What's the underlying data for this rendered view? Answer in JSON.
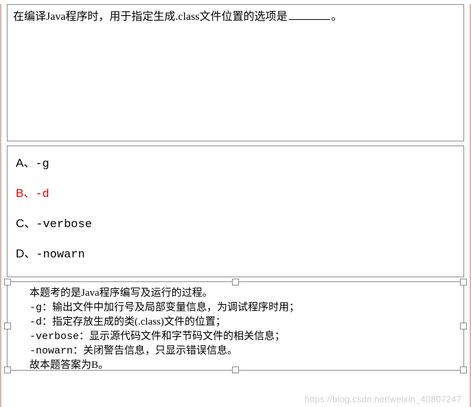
{
  "question": {
    "prefix": "在编译Java程序时，用于指定生成.class文件位置的选项是",
    "suffix": "。"
  },
  "options": [
    {
      "label": "A、",
      "value": "-g",
      "correct": false
    },
    {
      "label": "B、",
      "value": "-d",
      "correct": true
    },
    {
      "label": "C、",
      "value": "-verbose",
      "correct": false
    },
    {
      "label": "D、",
      "value": "-nowarn",
      "correct": false
    }
  ],
  "explanation": {
    "line1": "本题考的是Java程序编写及运行的过程。",
    "line2_flag": "-g：",
    "line2_rest": "输出文件中加行号及局部变量信息，为调试程序时用；",
    "line3_flag": "-d：",
    "line3_rest": "指定存放生成的类(.class)文件的位置；",
    "line4_flag": "-verbose：",
    "line4_rest": "显示源代码文件和字节码文件的相关信息；",
    "line5_flag": "-nowarn：",
    "line5_rest": "关闭警告信息，只显示错误信息。",
    "line6": "故本题答案为B。"
  },
  "watermark": "https://blog.csdn.net/weixin_40807247"
}
